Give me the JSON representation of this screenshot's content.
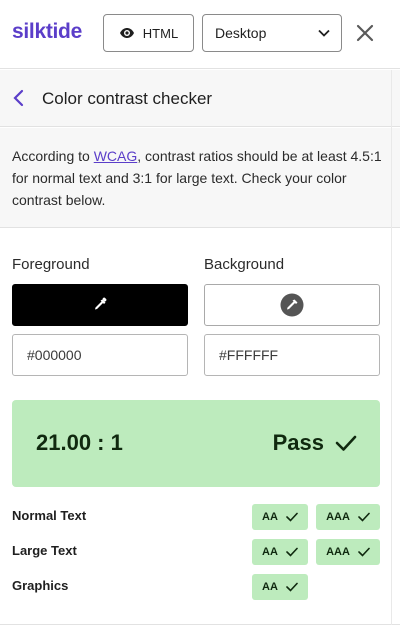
{
  "app": {
    "logo": "silktide"
  },
  "toolbar": {
    "html_button_label": "HTML",
    "device_select_value": "Desktop"
  },
  "panel": {
    "title": "Color contrast checker",
    "intro_before_link": "According to ",
    "intro_link": "WCAG",
    "intro_after_link": ", contrast ratios should be at least 4.5:1 for normal text and 3:1 for large text. Check your color contrast below."
  },
  "foreground": {
    "label": "Foreground",
    "value": "#000000",
    "color": "#000000"
  },
  "background": {
    "label": "Background",
    "value": "#FFFFFF",
    "color": "#FFFFFF"
  },
  "result": {
    "ratio": "21.00 : 1",
    "status": "Pass",
    "pass_color": "#bdebbd"
  },
  "levels": {
    "normal_text": {
      "label": "Normal Text",
      "aa": "AA",
      "aaa": "AAA"
    },
    "large_text": {
      "label": "Large Text",
      "aa": "AA",
      "aaa": "AAA"
    },
    "graphics": {
      "label": "Graphics",
      "aa": "AA"
    }
  },
  "icons": {
    "html_button": "eye-icon",
    "select": "chevron-down-icon",
    "close": "close-icon",
    "back": "chevron-left-icon",
    "picker": "eyedropper-icon",
    "check": "check-icon"
  }
}
